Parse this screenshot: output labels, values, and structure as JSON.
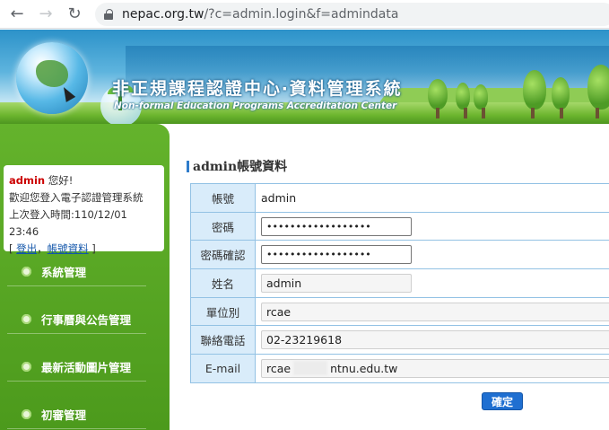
{
  "browser": {
    "url_host": "nepac.org.tw",
    "url_path": "/?c=admin.login&f=admindata"
  },
  "banner": {
    "title": "非正規課程認證中心‧資料管理系統",
    "subtitle": "Non-formal Education Programs Accreditation Center"
  },
  "login_box": {
    "username": "admin",
    "greeting": "您好!",
    "welcome": "歡迎您登入電子認證管理系統",
    "last_login": "上次登入時間:110/12/01 23:46",
    "logout_label": "登出",
    "account_label": "帳號資料"
  },
  "menu": [
    {
      "label": "系統管理"
    },
    {
      "label": "行事曆與公告管理"
    },
    {
      "label": "最新活動圖片管理"
    },
    {
      "label": "初審管理"
    }
  ],
  "main": {
    "title": "admin帳號資料",
    "fields": {
      "account_label": "帳號",
      "account_value": "admin",
      "password_label": "密碼",
      "password_value": "••••••••••••••••••",
      "confirm_label": "密碼確認",
      "confirm_value": "••••••••••••••••••",
      "name_label": "姓名",
      "name_value": "admin",
      "unit_label": "單位別",
      "unit_value": "rcae",
      "phone_label": "聯絡電話",
      "phone_value": "02-23219618",
      "email_label": "E-mail",
      "email_prefix": "rcae",
      "email_suffix": "ntnu.edu.tw"
    },
    "submit_label": "確定"
  }
}
